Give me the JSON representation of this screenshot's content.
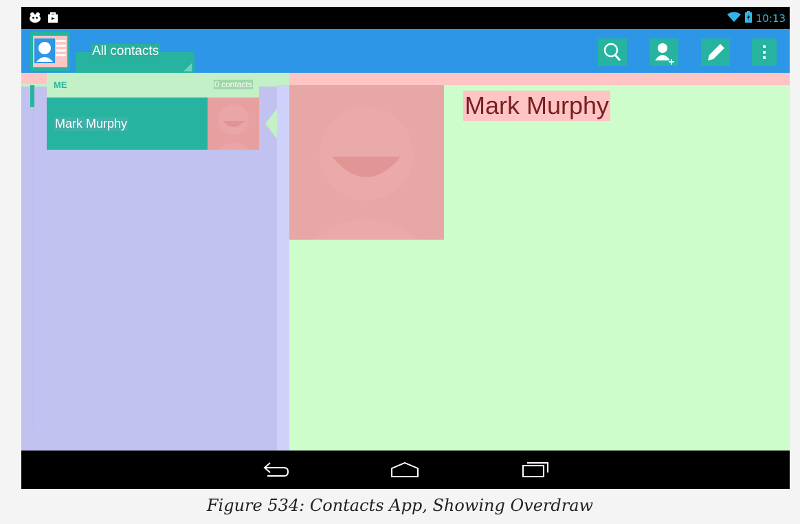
{
  "status_bar": {
    "time": "10:13",
    "icons": [
      "android-debug-icon",
      "shop-bag-icon",
      "wifi-icon",
      "battery-icon"
    ]
  },
  "action_bar": {
    "spinner_label": "All contacts",
    "actions": [
      "search-icon",
      "add-contact-icon",
      "edit-icon",
      "overflow-menu-icon"
    ]
  },
  "contact_list": {
    "section_header": "ME",
    "section_count": "0 contacts",
    "items": [
      {
        "name": "Mark Murphy"
      }
    ]
  },
  "detail": {
    "name": "Mark Murphy"
  },
  "nav_bar": {
    "buttons": [
      "back-icon",
      "home-icon",
      "recents-icon"
    ]
  },
  "caption": "Figure 534: Contacts App, Showing Overdraw",
  "colors": {
    "overdraw_1x": "#c1c2ef",
    "overdraw_2x": "#cdfdcb",
    "overdraw_3x": "#ffc4c4",
    "overdraw_4x": "#e79f9f",
    "teal": "#26b4a0",
    "actionbar": "#2d96e6"
  }
}
